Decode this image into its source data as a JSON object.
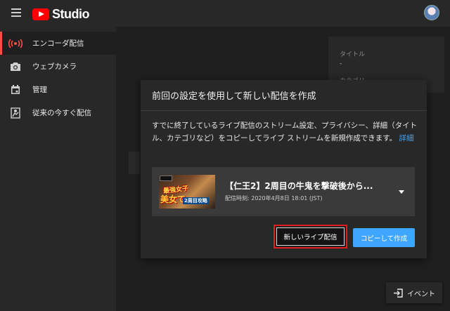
{
  "app": {
    "logo_text": "Studio"
  },
  "sidebar": {
    "items": [
      {
        "label": "エンコーダ配信",
        "icon": "broadcast-icon",
        "active": true
      },
      {
        "label": "ウェブカメラ",
        "icon": "camera-icon",
        "active": false
      },
      {
        "label": "管理",
        "icon": "calendar-icon",
        "active": false
      },
      {
        "label": "従来の今すぐ配信",
        "icon": "legacy-stream-icon",
        "active": false
      }
    ]
  },
  "background": {
    "title_label": "タイトル",
    "title_value": "-",
    "category_label": "カテゴリ"
  },
  "dialog": {
    "title": "前回の設定を使用して新しい配信を作成",
    "description": "すでに終了しているライブ配信のストリーム設定、プライバシー、詳細（タイトル、カテゴリなど）をコピーしてライブ ストリームを新規作成できます。",
    "details_link": "詳細",
    "stream": {
      "title": "【仁王2】2周目の牛鬼を撃破後から...",
      "subtitle": "配信時刻: 2020年4月8日 18:01 (JST)",
      "thumbnail_text_top": "最強女子",
      "thumbnail_text_main": "美女で",
      "thumbnail_text_sub": "2周目攻略"
    },
    "new_stream_button": "新しいライブ配信",
    "copy_button": "コピーして作成"
  },
  "event_button": {
    "label": "イベント"
  },
  "colors": {
    "accent": "#3ea6ff",
    "active_indicator": "#ff4e45",
    "highlight_border": "#e21d1d",
    "brand_red": "#ff0000"
  }
}
